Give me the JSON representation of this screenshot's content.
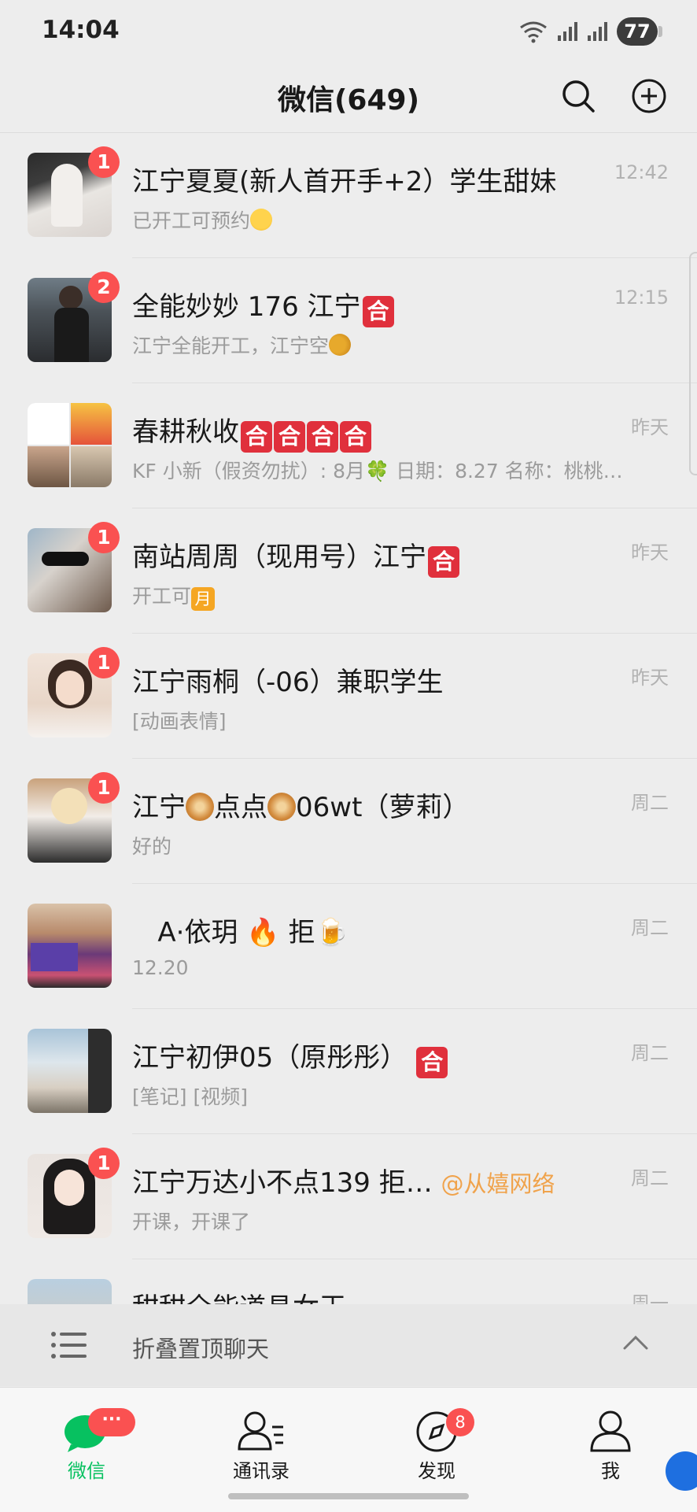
{
  "status_bar": {
    "time": "14:04",
    "battery": "77"
  },
  "header": {
    "title": "微信(649)",
    "search_icon": "search-icon",
    "add_icon": "plus-circle-icon"
  },
  "chats": [
    {
      "name": "江宁夏夏(新人首开手+2）学生甜妹",
      "time": "12:42",
      "preview": "已开工可预约",
      "badge": "1"
    },
    {
      "name": "全能妙妙 176 江宁",
      "time": "12:15",
      "preview": "江宁全能开工，江宁空",
      "badge": "2"
    },
    {
      "name": "春耕秋收",
      "time": "昨天",
      "preview": "KF 小新（假资勿扰）: 8月🍀 日期：8.27 名称：桃桃…",
      "badge": ""
    },
    {
      "name": "南站周周（现用号）江宁",
      "time": "昨天",
      "preview": "开工可",
      "badge": "1"
    },
    {
      "name": "江宁雨桐（-06）兼职学生",
      "time": "昨天",
      "preview": "[动画表情]",
      "badge": "1"
    },
    {
      "name_parts": [
        "江宁",
        "点点",
        "06wt（萝莉）"
      ],
      "time": "周二",
      "preview": "好的",
      "badge": "1"
    },
    {
      "name": "   A·依玥 🔥 拒🍺",
      "time": "周二",
      "preview": "12.20",
      "badge": ""
    },
    {
      "name": "江宁初伊05（原彤彤）",
      "time": "周二",
      "preview": "[笔记] [视频]",
      "badge": ""
    },
    {
      "name": "江宁万达小不点139   拒…",
      "mention": "@从嬉网络",
      "time": "周二",
      "preview": "开课，开课了",
      "badge": "1"
    },
    {
      "name": "甜甜全能道具女王",
      "time": "周一",
      "preview": "",
      "badge": ""
    }
  ],
  "glyphs": {
    "he": "合",
    "yue": "月"
  },
  "fold_bar": {
    "label": "折叠置顶聊天"
  },
  "tabs": [
    {
      "label": "微信",
      "badge": "···"
    },
    {
      "label": "通讯录",
      "badge": ""
    },
    {
      "label": "发现",
      "badge": "8"
    },
    {
      "label": "我",
      "badge": ""
    }
  ],
  "colors": {
    "brand_green": "#07c160",
    "badge_red": "#fa5151",
    "mention_orange": "#f0a34c"
  }
}
